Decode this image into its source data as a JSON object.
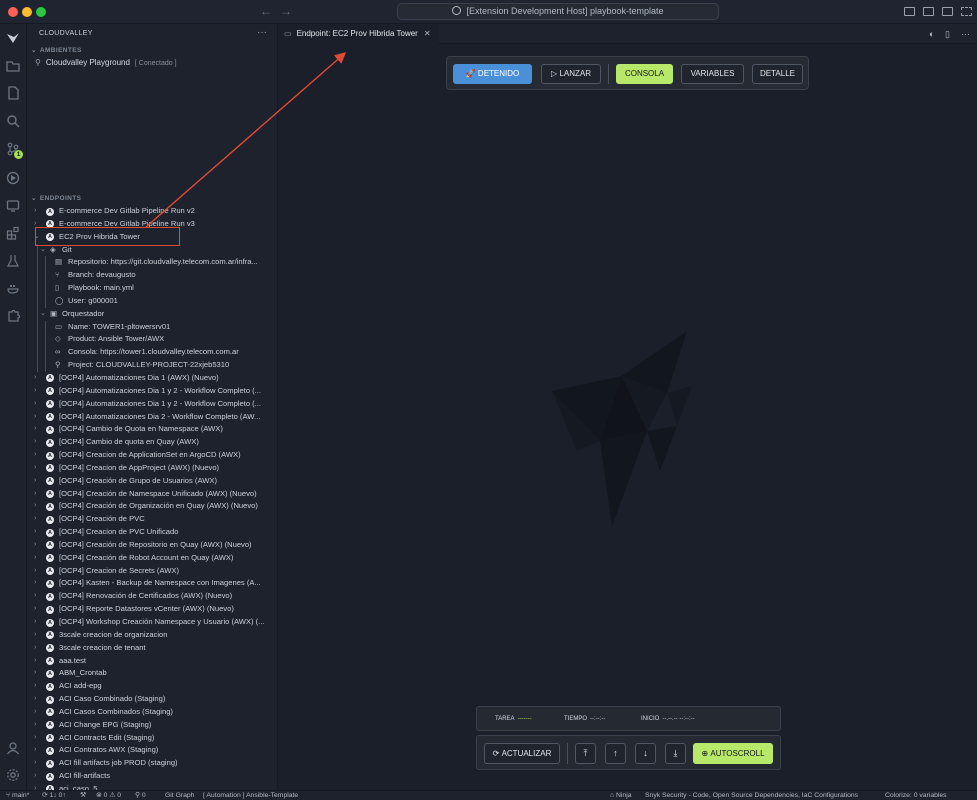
{
  "window": {
    "title": "[Extension Development Host] playbook-template"
  },
  "sidebar": {
    "title": "CLOUDVALLEY",
    "sections": {
      "ambientes": "AMBIENTES",
      "endpoints": "ENDPOINTS"
    },
    "environment": {
      "name": "Cloudvalley Playground",
      "status": "[ Conectado ]"
    },
    "tree": [
      {
        "kind": "endpoint",
        "label": "E-commerce Dev Gitlab Pipeline Run v2",
        "expanded": false
      },
      {
        "kind": "endpoint",
        "label": "E-commerce Dev Gitlab Pipeline Run v3",
        "expanded": false
      },
      {
        "kind": "endpoint",
        "label": "EC2 Prov Hibrida Tower",
        "expanded": true
      },
      {
        "kind": "group",
        "label": "Git",
        "icon": "git-icon"
      },
      {
        "kind": "leaf",
        "label": "Repositorio: https://git.cloudvalley.telecom.com.ar/infra...",
        "icon": "repo-icon"
      },
      {
        "kind": "leaf",
        "label": "Branch: devaugusto",
        "icon": "branch-icon"
      },
      {
        "kind": "leaf",
        "label": "Playbook: main.yml",
        "icon": "file-icon"
      },
      {
        "kind": "leaf",
        "label": "User: g000001",
        "icon": "user-icon"
      },
      {
        "kind": "group",
        "label": "Orquestador",
        "icon": "orchestrator-icon"
      },
      {
        "kind": "leaf",
        "label": "Name: TOWER1-pltowersrv01",
        "icon": "name-icon"
      },
      {
        "kind": "leaf",
        "label": "Product: Ansible Tower/AWX",
        "icon": "product-icon"
      },
      {
        "kind": "leaf",
        "label": "Consola: https://tower1.cloudvalley.telecom.com.ar",
        "icon": "link-icon"
      },
      {
        "kind": "leaf",
        "label": "Project: CLOUDVALLEY-PROJECT-22xjeb5310",
        "icon": "project-icon"
      },
      {
        "kind": "endpoint",
        "label": "[OCP4] Automatizaciones Dia 1 (AWX) (Nuevo)"
      },
      {
        "kind": "endpoint",
        "label": "[OCP4] Automatizaciones Dia 1 y 2 - Workflow Completo (..."
      },
      {
        "kind": "endpoint",
        "label": "[OCP4] Automatizaciones Dia 1 y 2 - Workflow Completo (..."
      },
      {
        "kind": "endpoint",
        "label": "[OCP4] Automatizaciones Dia 2 - Workflow Completo (AW..."
      },
      {
        "kind": "endpoint",
        "label": "[OCP4] Cambio de Quota en Namespace (AWX)"
      },
      {
        "kind": "endpoint",
        "label": "[OCP4] Cambio de quota en Quay (AWX)"
      },
      {
        "kind": "endpoint",
        "label": "[OCP4] Creacion de ApplicationSet en ArgoCD (AWX)"
      },
      {
        "kind": "endpoint",
        "label": "[OCP4] Creacion de AppProject (AWX) (Nuevo)"
      },
      {
        "kind": "endpoint",
        "label": "[OCP4] Creación de Grupo de Usuarios (AWX)"
      },
      {
        "kind": "endpoint",
        "label": "[OCP4] Creación de Namespace Unificado (AWX) (Nuevo)"
      },
      {
        "kind": "endpoint",
        "label": "[OCP4] Creación de Organización en Quay (AWX) (Nuevo)"
      },
      {
        "kind": "endpoint",
        "label": "[OCP4] Creación de PVC"
      },
      {
        "kind": "endpoint",
        "label": "[OCP4] Creacion de PVC Unificado"
      },
      {
        "kind": "endpoint",
        "label": "[OCP4] Creación de Repositorio en Quay (AWX) (Nuevo)"
      },
      {
        "kind": "endpoint",
        "label": "[OCP4] Creación de Robot Account en Quay (AWX)"
      },
      {
        "kind": "endpoint",
        "label": "[OCP4] Creacion de Secrets (AWX)"
      },
      {
        "kind": "endpoint",
        "label": "[OCP4] Kasten - Backup de Namespace con Imagenes (A..."
      },
      {
        "kind": "endpoint",
        "label": "[OCP4] Renovación de Certificados (AWX) (Nuevo)"
      },
      {
        "kind": "endpoint",
        "label": "[OCP4] Reporte Datastores vCenter (AWX) (Nuevo)"
      },
      {
        "kind": "endpoint",
        "label": "[OCP4] Workshop Creación Namespace y Usuario (AWX) (..."
      },
      {
        "kind": "endpoint",
        "label": "3scale creacion de organizacion"
      },
      {
        "kind": "endpoint",
        "label": "3scale creacion de tenant"
      },
      {
        "kind": "endpoint",
        "label": "aaa.test"
      },
      {
        "kind": "endpoint",
        "label": "ABM_Crontab"
      },
      {
        "kind": "endpoint",
        "label": "ACI add-epg"
      },
      {
        "kind": "endpoint",
        "label": "ACI Caso Combinado (Staging)"
      },
      {
        "kind": "endpoint",
        "label": "ACI Casos Combinados (Staging)"
      },
      {
        "kind": "endpoint",
        "label": "ACI Change EPG (Staging)"
      },
      {
        "kind": "endpoint",
        "label": "ACI Contracts Edit (Staging)"
      },
      {
        "kind": "endpoint",
        "label": "ACI Contratos AWX (Staging)"
      },
      {
        "kind": "endpoint",
        "label": "ACI fill artifacts job PROD (staging)"
      },
      {
        "kind": "endpoint",
        "label": "ACI fill-artifacts"
      },
      {
        "kind": "endpoint",
        "label": "aci_caso_5"
      }
    ]
  },
  "editor": {
    "tab": {
      "prefix": "Endpoint:",
      "title": "EC2 Prov Hibrida Tower"
    },
    "toolbar": {
      "detenido": "DETENIDO",
      "lanzar": "LANZAR",
      "consola": "CONSOLA",
      "variables": "VARIABLES",
      "detalle": "DETALLE"
    },
    "status": {
      "tarea_label": "TAREA",
      "tarea_value": "-------",
      "tiempo_label": "TIEMPO",
      "tiempo_value": "--:--:--",
      "inicio_label": "INICIO",
      "inicio_value": "--.--.-- --:--:--"
    },
    "controls": {
      "actualizar": "ACTUALIZAR",
      "autoscroll": "AUTOSCROLL"
    }
  },
  "statusbar": {
    "branch": "main*",
    "sync": "1↓ 0↑",
    "problems_errors": "0",
    "problems_warnings": "0",
    "ports": "0",
    "git_graph": "Git Graph",
    "automation": "[ Automation ] Ansible-Template",
    "ninja": "Ninja",
    "snyk": "Snyk Security - Code, Open Source Dependencies, IaC Configurations",
    "colorize": "Colorize: 0 variables"
  },
  "activity_badge": "1",
  "colors": {
    "accent_blue": "#4a90d9",
    "accent_green": "#b8e86a",
    "highlight_red": "#e04a35"
  }
}
